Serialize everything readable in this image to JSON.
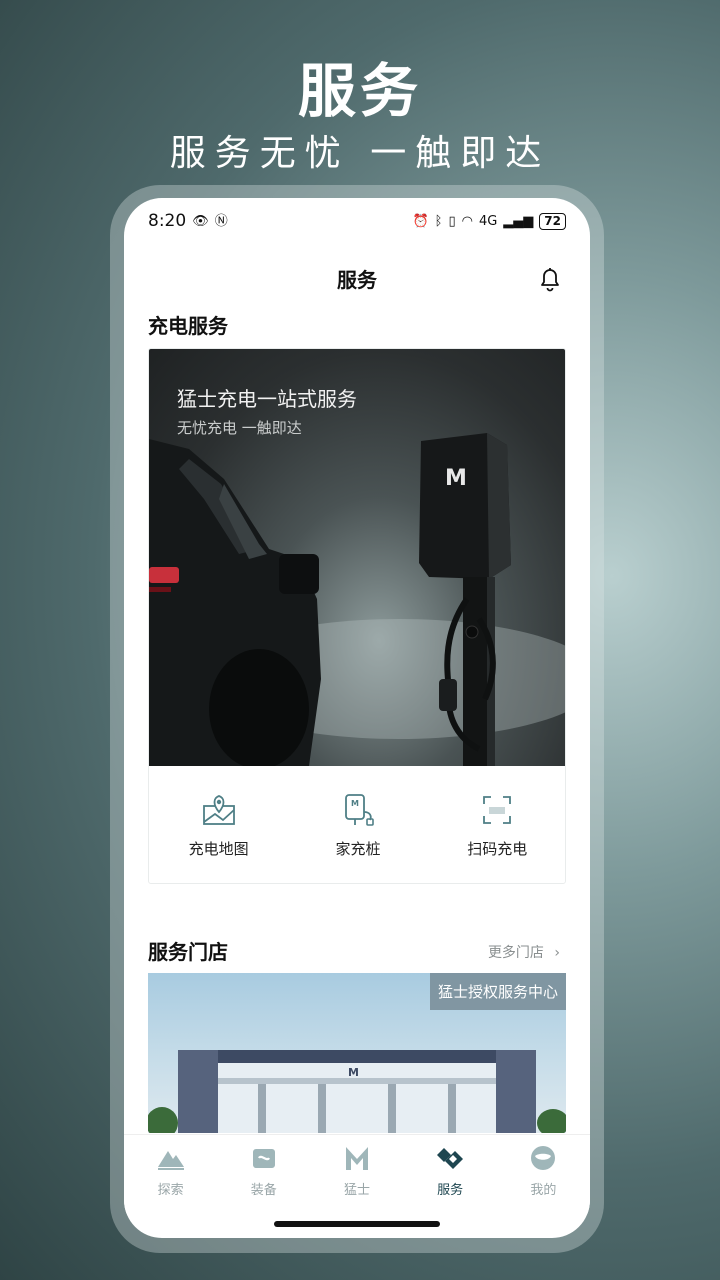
{
  "promo": {
    "title": "服务",
    "subtitle": "服务无忧 一触即达"
  },
  "status_bar": {
    "time": "8:20",
    "network": "4G",
    "battery": "72"
  },
  "header": {
    "title": "服务",
    "bell_icon": "bell-icon"
  },
  "charging": {
    "section_title": "充电服务",
    "hero_headline": "猛士充电一站式服务",
    "hero_sub": "无忧充电 一触即达",
    "actions": [
      {
        "label": "充电地图",
        "icon": "map-pin-icon"
      },
      {
        "label": "家充桩",
        "icon": "home-charger-icon"
      },
      {
        "label": "扫码充电",
        "icon": "scan-icon"
      }
    ]
  },
  "stores": {
    "section_title": "服务门店",
    "more_label": "更多门店",
    "badge": "猛士授权服务中心"
  },
  "tabs": [
    {
      "label": "探索",
      "icon": "mountain-icon",
      "active": false
    },
    {
      "label": "装备",
      "icon": "equipment-icon",
      "active": false
    },
    {
      "label": "猛士",
      "icon": "brand-logo-icon",
      "active": false
    },
    {
      "label": "服务",
      "icon": "handshake-icon",
      "active": true
    },
    {
      "label": "我的",
      "icon": "profile-mask-icon",
      "active": false
    }
  ],
  "colors": {
    "accent": "#1e4650",
    "inactive_tab": "#9aa6a8",
    "icon_teal": "#4f7f86"
  }
}
